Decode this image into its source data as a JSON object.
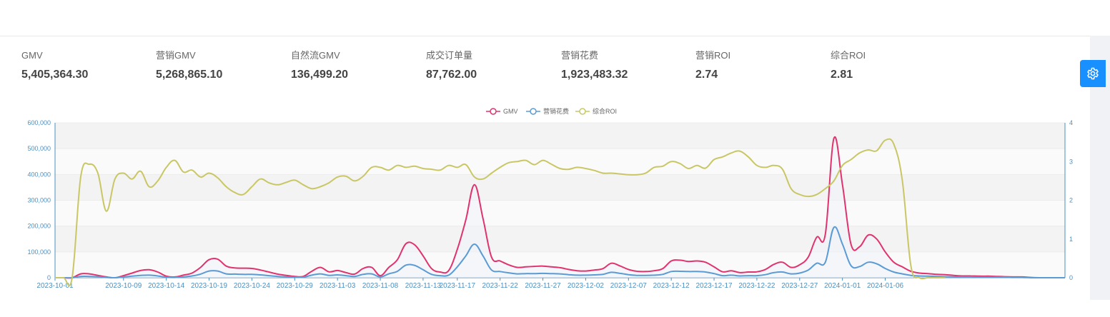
{
  "metrics": [
    {
      "label": "GMV",
      "value": "5,405,364.30"
    },
    {
      "label": "营销GMV",
      "value": "5,268,865.10"
    },
    {
      "label": "自然流GMV",
      "value": "136,499.20"
    },
    {
      "label": "成交订单量",
      "value": "87,762.00"
    },
    {
      "label": "营销花费",
      "value": "1,923,483.32"
    },
    {
      "label": "营销ROI",
      "value": "2.74"
    },
    {
      "label": "综合ROI",
      "value": "2.81"
    }
  ],
  "settings": {
    "icon": "gear-icon"
  },
  "chart_data": {
    "type": "line",
    "start_date": "2023-10-01",
    "x_tick_labels": [
      "2023-10-01",
      "2023-10-09",
      "2023-10-14",
      "2023-10-19",
      "2023-10-24",
      "2023-10-29",
      "2023-11-03",
      "2023-11-08",
      "2023-11-13",
      "2023-11-17",
      "2023-11-22",
      "2023-11-27",
      "2023-12-02",
      "2023-12-07",
      "2023-12-12",
      "2023-12-17",
      "2023-12-22",
      "2023-12-27",
      "2024-01-01",
      "2024-01-06"
    ],
    "y_left": {
      "min": 0,
      "max": 600000,
      "ticks": [
        "0",
        "100,000",
        "200,000",
        "300,000",
        "400,000",
        "500,000",
        "600,000"
      ]
    },
    "y_right": {
      "min": 0,
      "max": 4,
      "ticks": [
        "0",
        "1",
        "2",
        "3",
        "4"
      ]
    },
    "legend": {
      "position": "top-center"
    },
    "series": [
      {
        "name": "GMV",
        "axis": "left",
        "color": "#e0336d",
        "values": [
          0,
          0,
          0,
          15000,
          15000,
          9000,
          3000,
          0,
          8000,
          18000,
          28000,
          31000,
          22000,
          6000,
          3000,
          10000,
          18000,
          40000,
          70000,
          72000,
          45000,
          38000,
          37000,
          36000,
          30000,
          22000,
          14000,
          9000,
          5000,
          5000,
          25000,
          40000,
          23000,
          28000,
          20000,
          14000,
          36000,
          40000,
          8000,
          40000,
          70000,
          132000,
          128000,
          85000,
          35000,
          22000,
          28000,
          110000,
          225000,
          360000,
          230000,
          80000,
          65000,
          50000,
          40000,
          42000,
          44000,
          45000,
          42000,
          39000,
          32000,
          27000,
          26000,
          30000,
          35000,
          56000,
          46000,
          32000,
          25000,
          24000,
          27000,
          35000,
          65000,
          68000,
          63000,
          65000,
          60000,
          42000,
          23000,
          27000,
          20000,
          22000,
          23000,
          32000,
          52000,
          60000,
          40000,
          50000,
          80000,
          157000,
          168000,
          540000,
          360000,
          130000,
          120000,
          165000,
          150000,
          100000,
          60000,
          42000,
          25000,
          18000,
          16000,
          13000,
          12000,
          9000,
          7000,
          7000,
          6000,
          6000,
          5000,
          4000,
          3000,
          3000,
          1000,
          0,
          0,
          0,
          0
        ]
      },
      {
        "name": "营销花费",
        "axis": "left",
        "color": "#5b9bd5",
        "values": [
          0,
          0,
          0,
          5000,
          5000,
          4000,
          1000,
          0,
          3000,
          6000,
          9000,
          10000,
          7000,
          2000,
          1000,
          3000,
          7000,
          14000,
          26000,
          26000,
          15000,
          14000,
          13000,
          13000,
          11000,
          8000,
          5000,
          3000,
          2000,
          2000,
          10000,
          15000,
          9000,
          11000,
          8000,
          5000,
          13000,
          15000,
          3000,
          15000,
          25000,
          49000,
          48000,
          31000,
          13000,
          8000,
          10000,
          42000,
          85000,
          130000,
          85000,
          30000,
          24000,
          19000,
          15000,
          16000,
          16000,
          17000,
          16000,
          15000,
          12000,
          10000,
          10000,
          11000,
          13000,
          21000,
          17000,
          12000,
          9000,
          9000,
          10000,
          13000,
          24000,
          25000,
          24000,
          24000,
          22000,
          16000,
          8000,
          10000,
          7000,
          8000,
          8000,
          12000,
          20000,
          22000,
          15000,
          18000,
          30000,
          56000,
          60000,
          195000,
          130000,
          47000,
          43000,
          60000,
          54000,
          36000,
          22000,
          15000,
          9000,
          7000,
          6000,
          5000,
          4000,
          3000,
          3000,
          3000,
          2000,
          2000,
          2000,
          2000,
          1000,
          1000,
          0,
          0,
          0,
          0,
          0
        ]
      },
      {
        "name": "综合ROI",
        "axis": "right",
        "color": "#c9c765",
        "values": [
          0,
          0,
          0,
          2.6,
          2.93,
          2.7,
          1.72,
          2.55,
          2.7,
          2.55,
          2.75,
          2.35,
          2.5,
          2.85,
          3.03,
          2.73,
          2.78,
          2.6,
          2.7,
          2.58,
          2.35,
          2.2,
          2.15,
          2.35,
          2.55,
          2.45,
          2.4,
          2.46,
          2.52,
          2.4,
          2.3,
          2.35,
          2.45,
          2.6,
          2.62,
          2.5,
          2.62,
          2.85,
          2.85,
          2.78,
          2.9,
          2.85,
          2.88,
          2.82,
          2.8,
          2.78,
          2.9,
          2.85,
          2.92,
          2.6,
          2.55,
          2.7,
          2.85,
          2.97,
          3.0,
          3.03,
          2.92,
          3.03,
          2.93,
          2.82,
          2.8,
          2.85,
          2.82,
          2.77,
          2.7,
          2.7,
          2.68,
          2.66,
          2.66,
          2.7,
          2.85,
          2.88,
          3.0,
          2.95,
          2.82,
          2.9,
          2.83,
          3.05,
          3.12,
          3.22,
          3.27,
          3.12,
          2.9,
          2.85,
          2.9,
          2.8,
          2.3,
          2.15,
          2.1,
          2.15,
          2.3,
          2.5,
          2.9,
          3.05,
          3.22,
          3.3,
          3.28,
          3.55,
          3.45,
          2.5,
          0.3,
          0,
          0,
          0,
          0
        ]
      }
    ]
  }
}
